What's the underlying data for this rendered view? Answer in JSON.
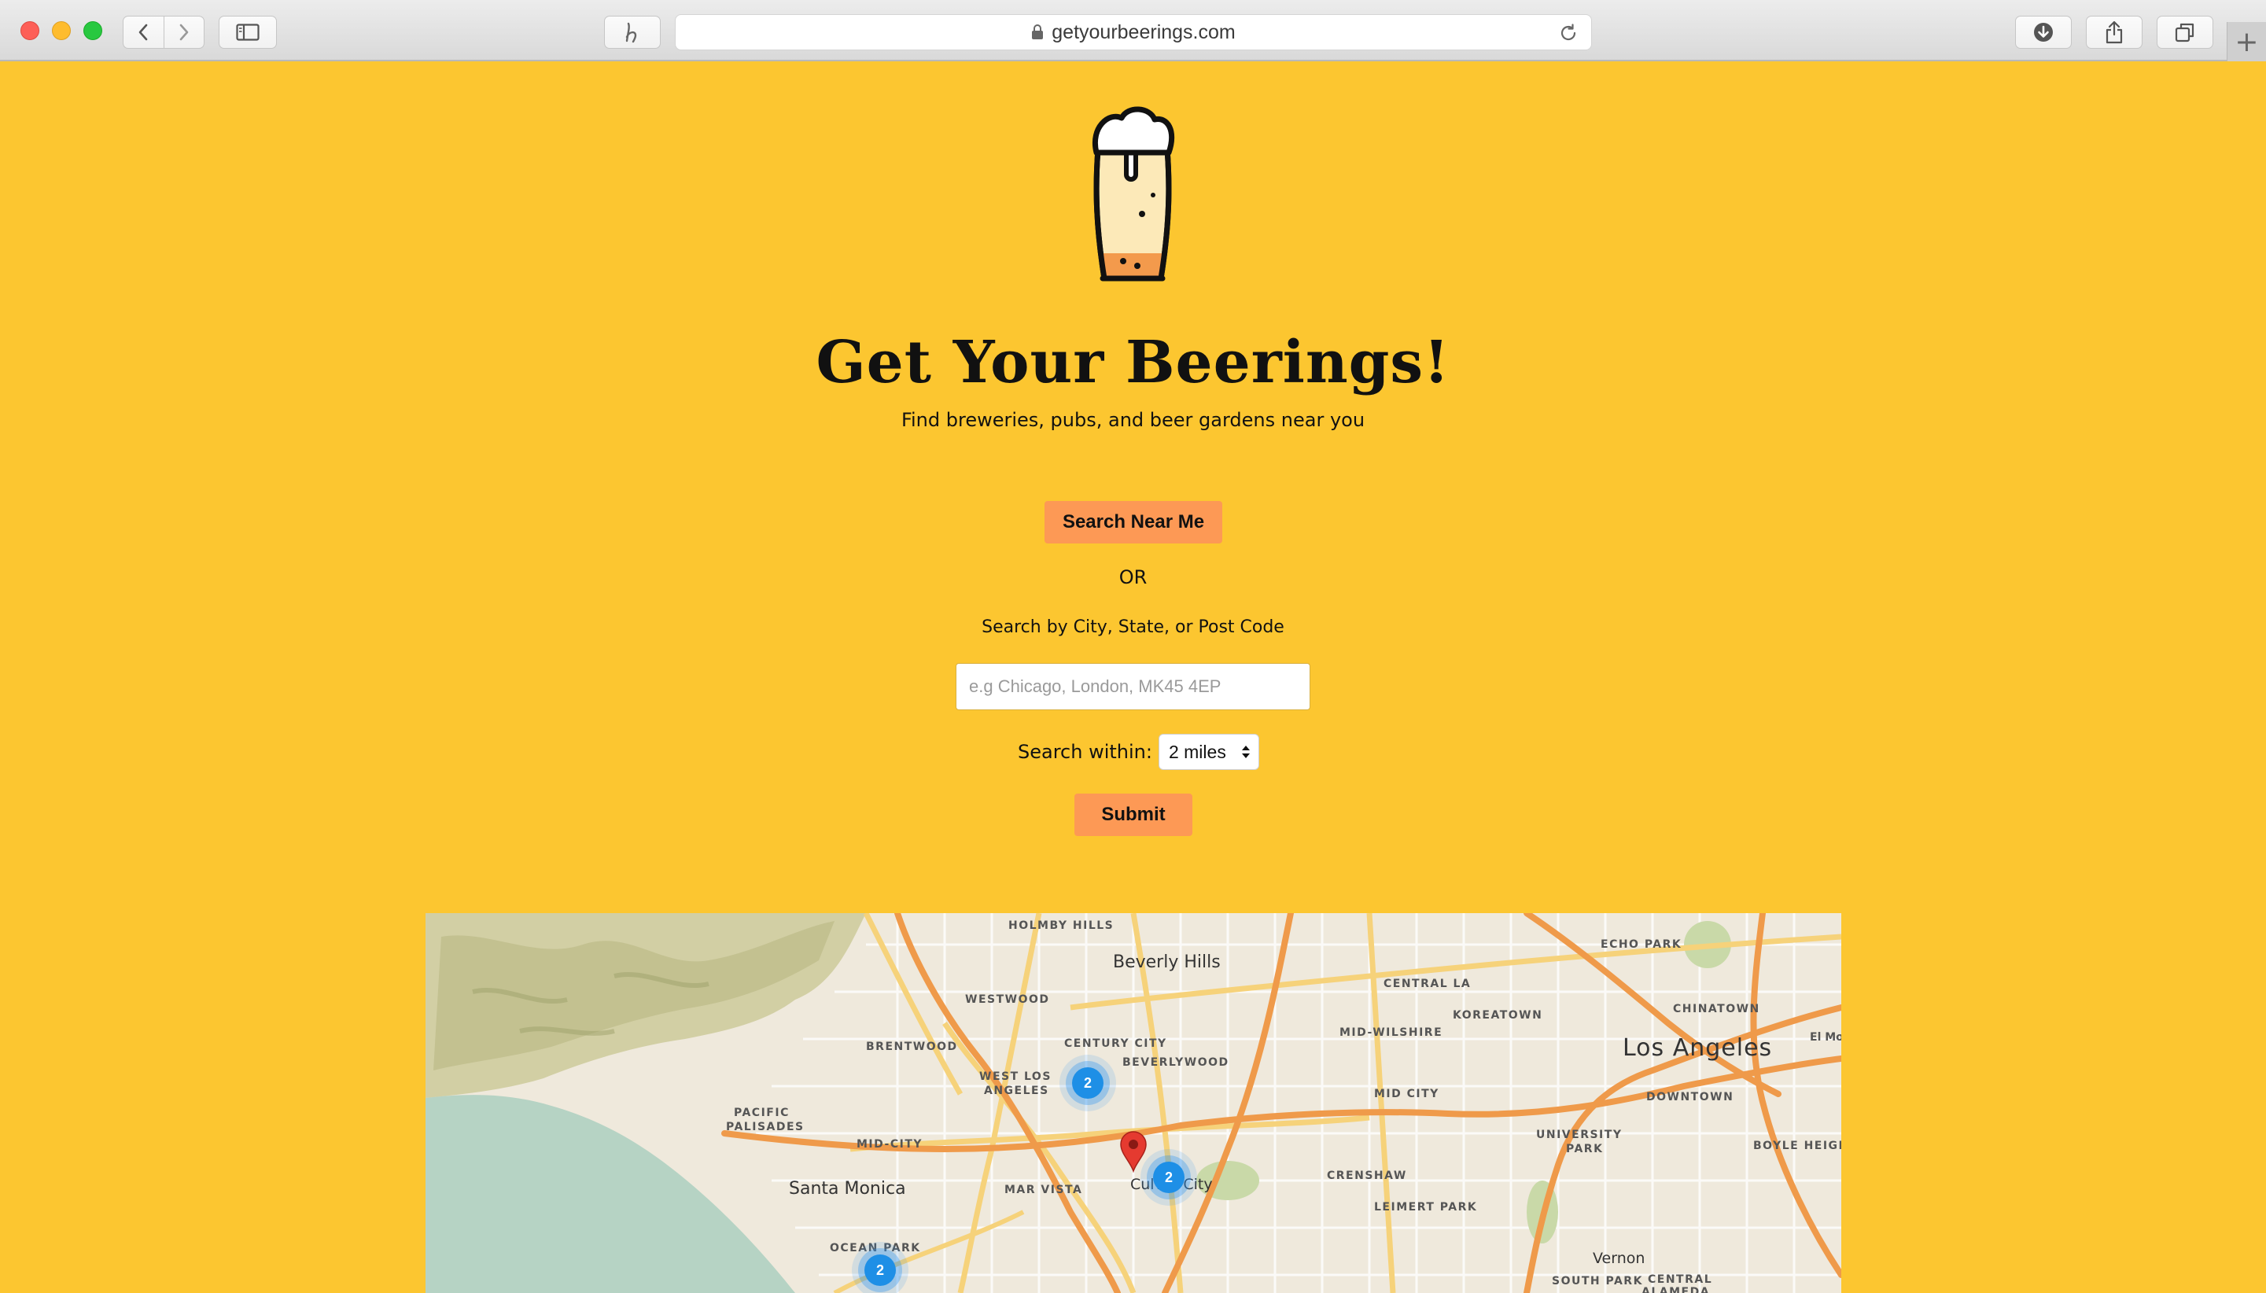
{
  "browser": {
    "url": "getyourbeerings.com",
    "new_tab_label": "+"
  },
  "hero": {
    "title": "Get Your Beerings!",
    "subtitle": "Find breweries, pubs, and beer gardens near you"
  },
  "search": {
    "near_me_label": "Search Near Me",
    "or_label": "OR",
    "city_label": "Search by City, State, or Post Code",
    "city_value": "",
    "city_placeholder": "e.g Chicago, London, MK45 4EP",
    "within_label": "Search within:",
    "within_value": "2 miles",
    "submit_label": "Submit"
  },
  "map": {
    "labels": [
      {
        "text": "HOLMBY HILLS",
        "class": "small"
      },
      {
        "text": "Beverly Hills",
        "class": "big"
      },
      {
        "text": "WESTWOOD",
        "class": "small"
      },
      {
        "text": "BRENTWOOD",
        "class": "small"
      },
      {
        "text": "CENTURY CITY",
        "class": "small"
      },
      {
        "text": "BEVERLYWOOD",
        "class": "small"
      },
      {
        "text": "WEST LOS",
        "class": "small"
      },
      {
        "text": "ANGELES",
        "class": "small"
      },
      {
        "text": "PACIFIC",
        "class": "small"
      },
      {
        "text": "PALISADES",
        "class": "small"
      },
      {
        "text": "MID-CITY",
        "class": "small"
      },
      {
        "text": "Santa Monica",
        "class": "big"
      },
      {
        "text": "MAR VISTA",
        "class": "small"
      },
      {
        "text": "OCEAN PARK",
        "class": "small"
      },
      {
        "text": "Culver City",
        "class": "big"
      },
      {
        "text": "CENTRAL LA",
        "class": "small"
      },
      {
        "text": "MID-WILSHIRE",
        "class": "small"
      },
      {
        "text": "KOREATOWN",
        "class": "small"
      },
      {
        "text": "MID CITY",
        "class": "small"
      },
      {
        "text": "CRENSHAW",
        "class": "small"
      },
      {
        "text": "LEIMERT PARK",
        "class": "small"
      },
      {
        "text": "ECHO PARK",
        "class": "small"
      },
      {
        "text": "CHINATOWN",
        "class": "small"
      },
      {
        "text": "Los Angeles",
        "class": "huge"
      },
      {
        "text": "DOWNTOWN",
        "class": "small"
      },
      {
        "text": "UNIVERSITY",
        "class": "small"
      },
      {
        "text": "PARK",
        "class": "small"
      },
      {
        "text": "BOYLE HEIGHTS",
        "class": "small"
      },
      {
        "text": "Vernon",
        "class": "big"
      },
      {
        "text": "SOUTH PARK",
        "class": "small"
      },
      {
        "text": "CENTRAL",
        "class": "small"
      },
      {
        "text": "ALAMEDA",
        "class": "small"
      },
      {
        "text": "El Mo",
        "class": "small"
      }
    ],
    "clusters": [
      {
        "count": "2"
      },
      {
        "count": "2"
      },
      {
        "count": "2"
      }
    ],
    "colors": {
      "land": "#efe9dc",
      "water": "#b6d3c4",
      "hills": "#c8c49a",
      "highway": "#ef9a4a",
      "arterial": "#f6d27a",
      "cluster": "#1e8fe6",
      "pin": "#e53a30"
    }
  },
  "theme": {
    "page_bg": "#fcc630",
    "button_bg": "#fd9955"
  }
}
